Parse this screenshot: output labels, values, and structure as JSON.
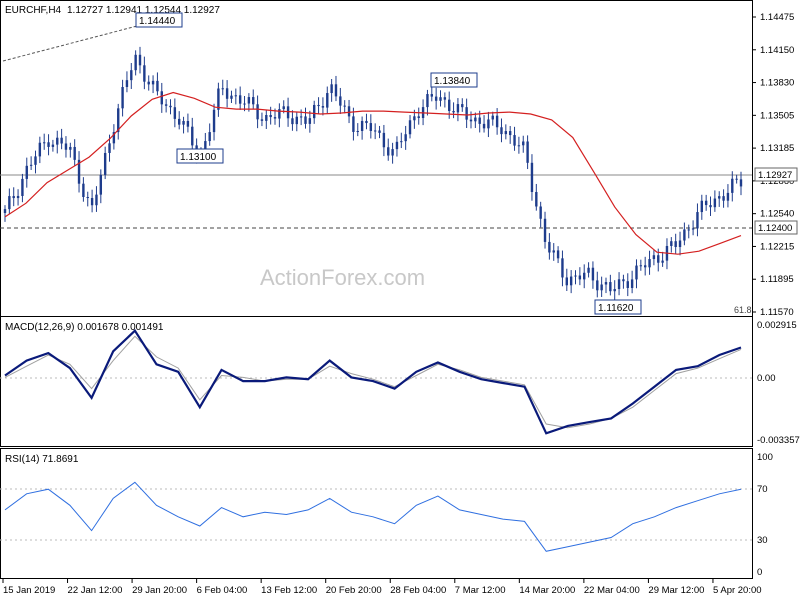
{
  "header": {
    "symbol_timeframe": "EURCHF,H4",
    "ohlc": "1.12727 1.12941 1.12544 1.12927"
  },
  "watermark": "ActionForex.com",
  "colors": {
    "background": "#ffffff",
    "candle": "#1e3c8c",
    "moving_average": "#d42020",
    "macd_line": "#0a1a7a",
    "macd_signal": "#a0a0a0",
    "rsi_line": "#2f6fe0",
    "reference_line": "#555555",
    "label_border": "#1e3c8c"
  },
  "chart_data": [
    {
      "type": "candlestick",
      "title": "EURCHF,H4",
      "y_ticks": [
        "1.14475",
        "1.14150",
        "1.13830",
        "1.13505",
        "1.13185",
        "1.12860",
        "1.12540",
        "1.12215",
        "1.11895",
        "1.11570"
      ],
      "ylim": [
        1.1157,
        1.1458
      ],
      "current_price_label": "1.12927",
      "current_price": 1.12927,
      "horizontal_level": {
        "value": 1.124,
        "label": "1.12400",
        "style": "dashed"
      },
      "fib_label": "61.8",
      "annotations": [
        {
          "text": "1.14440",
          "value": 1.1444
        },
        {
          "text": "1.13100",
          "value": 1.131
        },
        {
          "text": "1.13840",
          "value": 1.1384
        },
        {
          "text": "1.11620",
          "value": 1.1162
        }
      ],
      "trendline": {
        "from": 1.1398,
        "to": 1.1444,
        "style": "dotted"
      },
      "moving_average_keypoints": [
        1.1254,
        1.1268,
        1.1289,
        1.1302,
        1.1315,
        1.1334,
        1.1357,
        1.1374,
        1.1381,
        1.1375,
        1.1366,
        1.1364,
        1.1364,
        1.1362,
        1.1361,
        1.1359,
        1.136,
        1.1362,
        1.1362,
        1.1361,
        1.136,
        1.1359,
        1.1358,
        1.136,
        1.1361,
        1.1359,
        1.1353,
        1.1335,
        1.13,
        1.1264,
        1.1236,
        1.1218,
        1.1216,
        1.1219,
        1.1227,
        1.1235
      ]
    },
    {
      "type": "line",
      "title": "MACD(12,26,9) 0.001678 0.001491",
      "y_ticks": [
        "0.002915",
        "0.00",
        "-0.003357"
      ],
      "ylim": [
        -0.003357,
        0.002915
      ],
      "series": [
        {
          "name": "MACD",
          "values": [
            0.0001,
            0.0009,
            0.0013,
            0.0005,
            -0.0011,
            0.0014,
            0.0025,
            0.0007,
            0.0003,
            -0.0016,
            0.0004,
            -0.0002,
            -0.0002,
            0.0,
            -0.0001,
            0.0009,
            0.0,
            -0.0002,
            -0.0006,
            0.0003,
            0.0008,
            0.0003,
            -0.0001,
            -0.0003,
            -0.0005,
            -0.003,
            -0.0026,
            -0.0024,
            -0.0022,
            -0.0014,
            -0.0005,
            0.0004,
            0.0006,
            0.0012,
            0.0016
          ]
        },
        {
          "name": "Signal",
          "values": [
            0.0,
            0.0006,
            0.0012,
            0.0007,
            -0.0006,
            0.0009,
            0.0022,
            0.0011,
            0.0005,
            -0.0012,
            0.0001,
            0.0,
            -0.0002,
            -0.0001,
            -0.0001,
            0.0006,
            0.0002,
            -0.0001,
            -0.0005,
            0.0001,
            0.0007,
            0.0004,
            0.0,
            -0.0002,
            -0.0004,
            -0.0025,
            -0.0027,
            -0.0025,
            -0.0022,
            -0.0016,
            -0.0007,
            0.0002,
            0.0005,
            0.001,
            0.0015
          ]
        }
      ]
    },
    {
      "type": "line",
      "title": "RSI(14) 71.8691",
      "y_ticks": [
        "100",
        "70",
        "30",
        "0"
      ],
      "ylim": [
        0,
        100
      ],
      "levels": [
        70,
        30
      ],
      "series": [
        {
          "name": "RSI(14)",
          "values": [
            54,
            68,
            72,
            58,
            36,
            64,
            78,
            58,
            48,
            40,
            56,
            48,
            52,
            50,
            54,
            64,
            52,
            48,
            42,
            58,
            66,
            54,
            50,
            46,
            44,
            18,
            22,
            26,
            30,
            42,
            48,
            56,
            62,
            68,
            72
          ]
        }
      ]
    }
  ],
  "x_axis": {
    "labels": [
      "15 Jan 2019",
      "22 Jan 12:00",
      "29 Jan 20:00",
      "6 Feb 04:00",
      "13 Feb 12:00",
      "20 Feb 20:00",
      "28 Feb 04:00",
      "7 Mar 12:00",
      "14 Mar 20:00",
      "22 Mar 04:00",
      "29 Mar 12:00",
      "5 Apr 20:00"
    ]
  }
}
